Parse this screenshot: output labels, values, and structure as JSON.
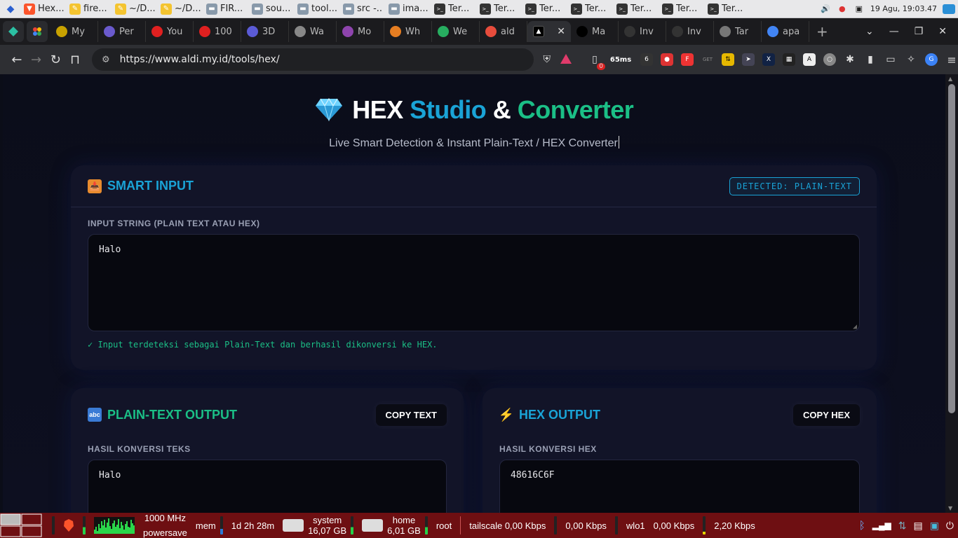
{
  "os_taskbar": {
    "tasks": [
      {
        "icon": "brave-icon",
        "label": "Hex..."
      },
      {
        "icon": "notes-icon",
        "label": "fire..."
      },
      {
        "icon": "notes-icon",
        "label": "~/D..."
      },
      {
        "icon": "notes-icon",
        "label": "~/D..."
      },
      {
        "icon": "folder-icon",
        "label": "FIR..."
      },
      {
        "icon": "folder-icon",
        "label": "sou..."
      },
      {
        "icon": "folder-icon",
        "label": "tool..."
      },
      {
        "icon": "folder-icon",
        "label": "src -..."
      },
      {
        "icon": "folder-icon",
        "label": "ima..."
      },
      {
        "icon": "terminal-icon",
        "label": "Ter..."
      },
      {
        "icon": "terminal-icon",
        "label": "Ter..."
      },
      {
        "icon": "terminal-icon",
        "label": "Ter..."
      },
      {
        "icon": "terminal-icon",
        "label": "Ter..."
      },
      {
        "icon": "terminal-icon",
        "label": "Ter..."
      },
      {
        "icon": "terminal-icon",
        "label": "Ter..."
      },
      {
        "icon": "terminal-icon",
        "label": "Ter..."
      }
    ],
    "clock": "19 Agu, 19:03.47"
  },
  "browser": {
    "tabs": [
      {
        "label": "My",
        "color": "#c8a200"
      },
      {
        "label": "Per",
        "color": "#6a5acd"
      },
      {
        "label": "You",
        "color": "#e02020"
      },
      {
        "label": "100",
        "color": "#e02020"
      },
      {
        "label": "3D",
        "color": "#5b5bd6"
      },
      {
        "label": "Wa",
        "color": "#888888"
      },
      {
        "label": "Mo",
        "color": "#8e44ad"
      },
      {
        "label": "Wh",
        "color": "#e67e22"
      },
      {
        "label": "We",
        "color": "#27ae60"
      },
      {
        "label": "ald",
        "color": "#e74c3c"
      }
    ],
    "active_tab": {
      "label": "",
      "color": "#000000"
    },
    "trailing_tabs": [
      {
        "label": "Ma",
        "color": "#000000"
      },
      {
        "label": "Inv",
        "color": "#333333"
      },
      {
        "label": "Inv",
        "color": "#333333"
      },
      {
        "label": "Tar",
        "color": "#777777"
      },
      {
        "label": "apa",
        "color": "#4285f4"
      }
    ],
    "url": "https://www.aldi.my.id/tools/hex/",
    "ext_badge": "0",
    "ping": "65ms"
  },
  "page": {
    "title_part1": "HEX",
    "title_part2": "Studio",
    "title_amp": "&",
    "title_part3": "Converter",
    "subtitle": "Live Smart Detection & Instant Plain-Text / HEX Converter",
    "smart_input": {
      "title": "SMART INPUT",
      "badge": "DETECTED: PLAIN-TEXT",
      "label": "INPUT STRING (PLAIN TEXT ATAU HEX)",
      "value": "Halo",
      "status": "✓ Input terdeteksi sebagai Plain-Text dan berhasil dikonversi ke HEX."
    },
    "plain_output": {
      "title": "PLAIN-TEXT OUTPUT",
      "copy_label": "COPY TEXT",
      "label": "HASIL KONVERSI TEKS",
      "value": "Halo"
    },
    "hex_output": {
      "title": "HEX OUTPUT",
      "copy_label": "COPY HEX",
      "label": "HASIL KONVERSI HEX",
      "value": "48616C6F"
    }
  },
  "bottom_panel": {
    "cpu_freq": "1000 MHz",
    "cpu_gov": "powersave",
    "mem": "mem",
    "uptime": "1d 2h 28m",
    "system_label": "system",
    "system_size": "16,07 GB",
    "home_label": "home",
    "home_size": "6,01 GB",
    "root_label": "root",
    "tailscale": "tailscale 0,00 Kbps",
    "tailscale_out": "0,00 Kbps",
    "wlo1": "wlo1",
    "wlo1_in": "0,00 Kbps",
    "wlo1_out": "2,20 Kbps"
  }
}
